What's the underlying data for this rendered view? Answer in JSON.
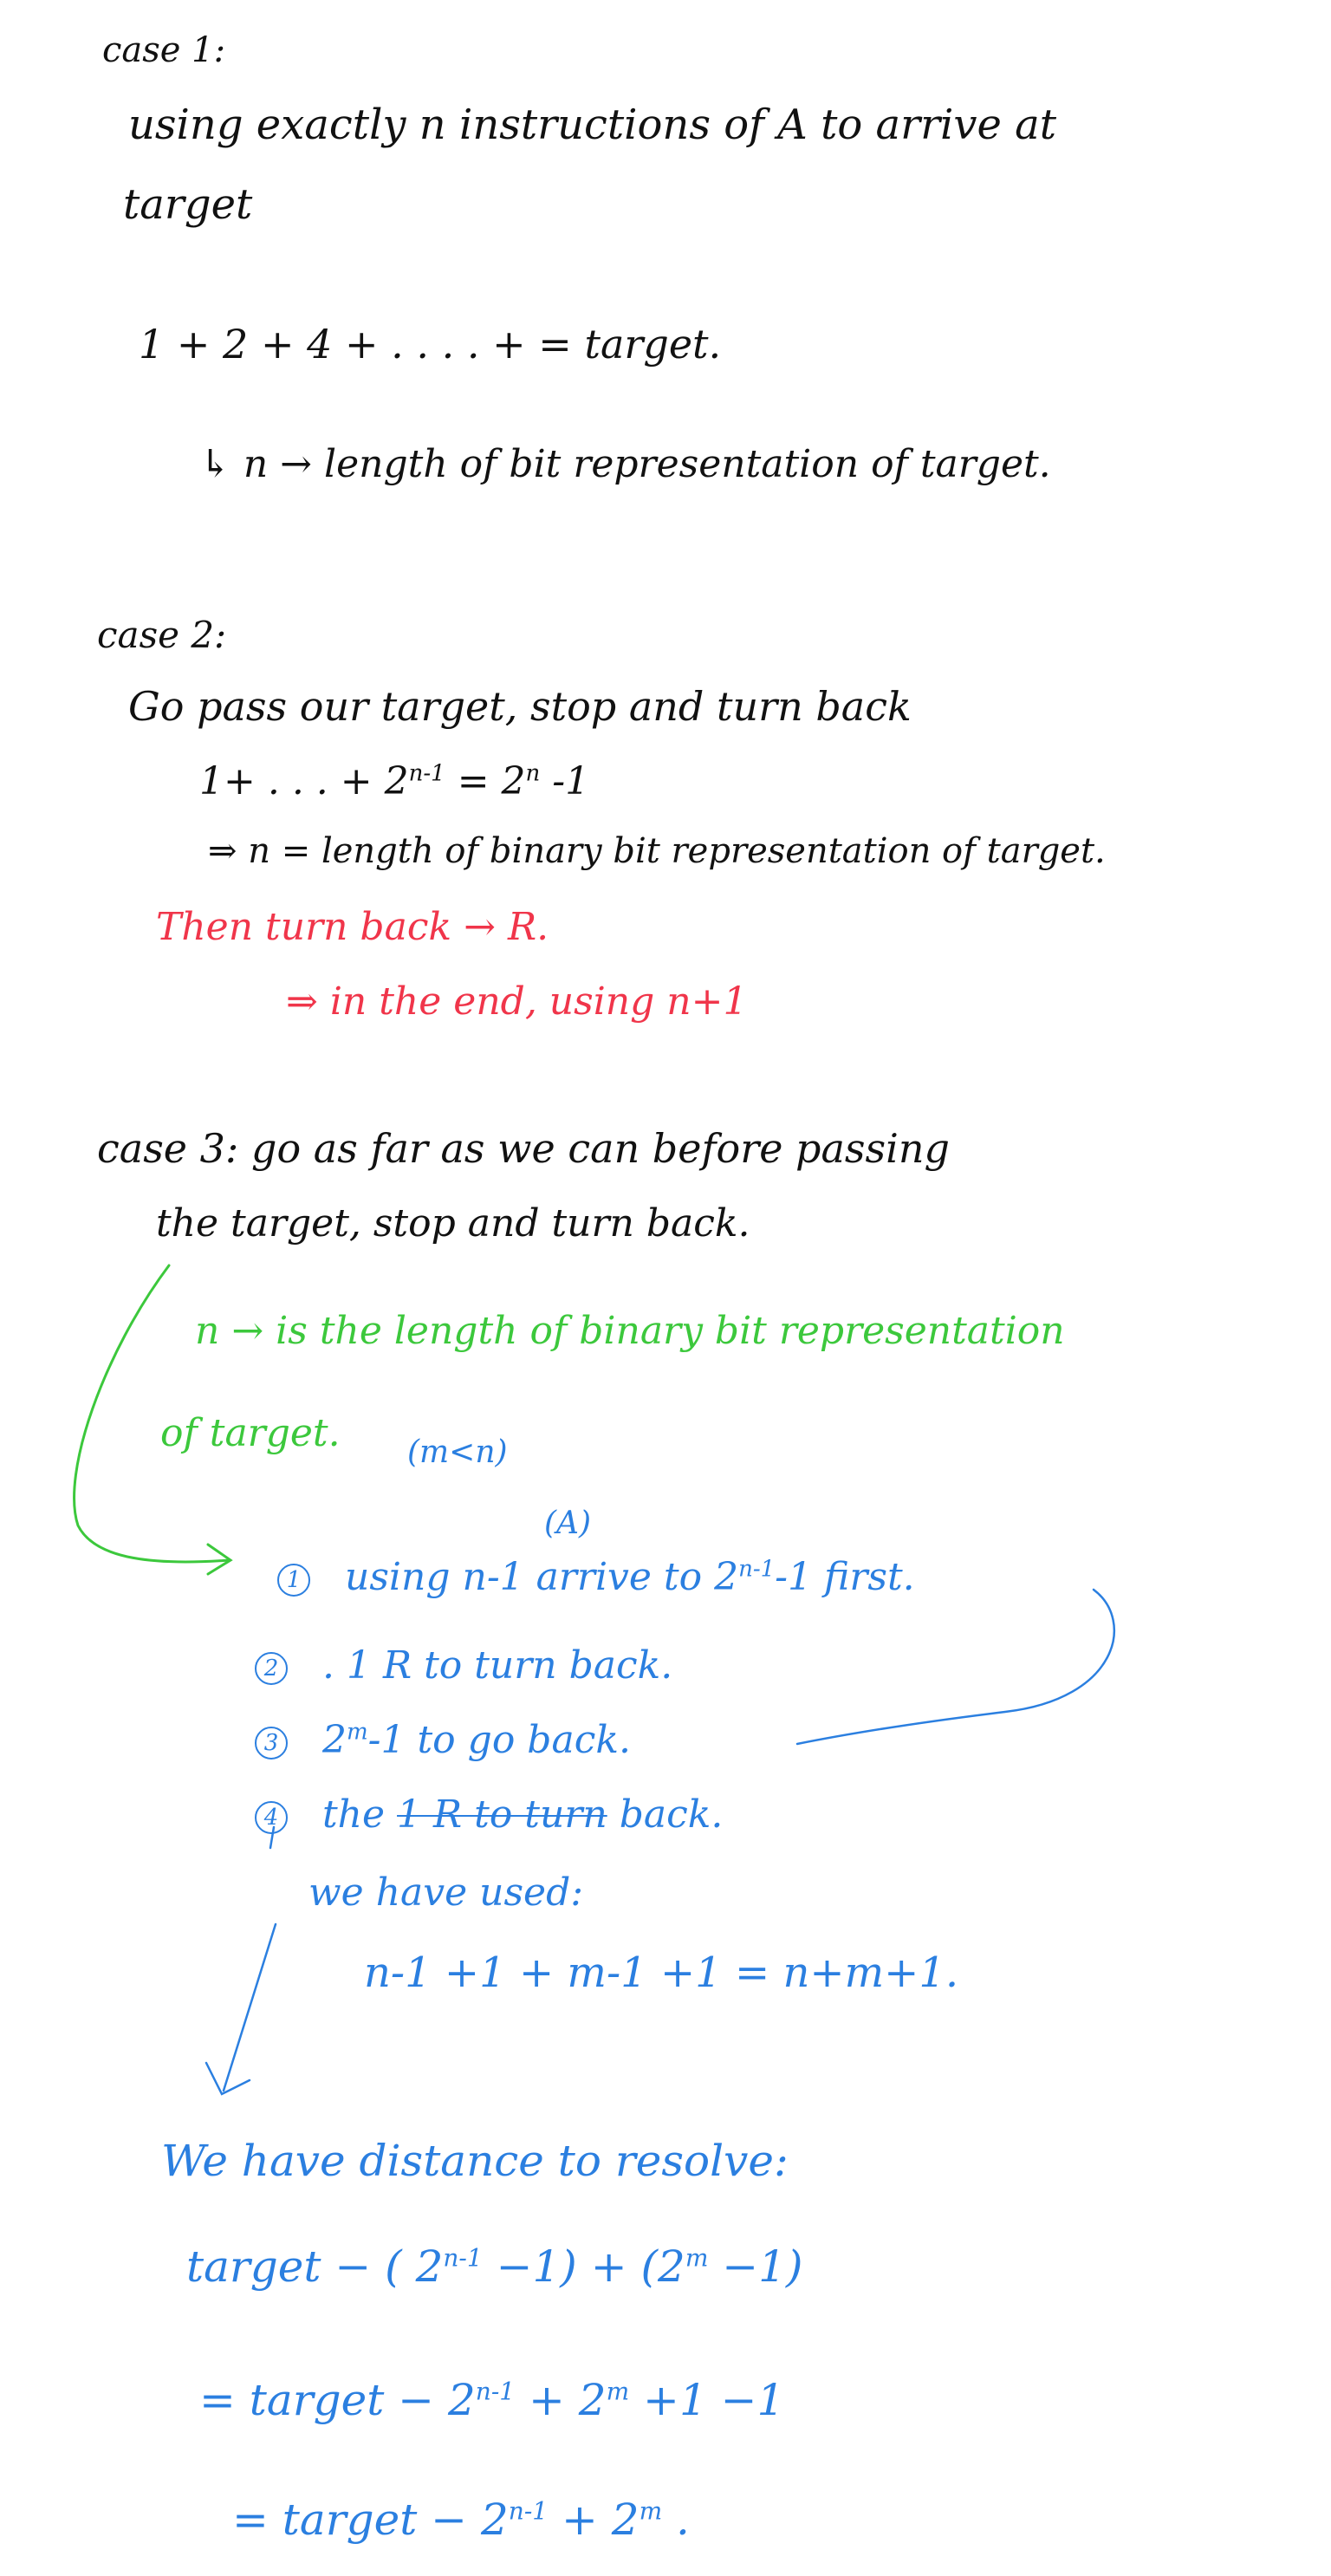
{
  "case1": {
    "heading": "case 1:",
    "line1": "using exactly n instructions of A to arrive at",
    "line2": "target",
    "sum": "1 + 2 + 4 + . . . . +    = target.",
    "note": "↳ n → length of bit representation of target."
  },
  "case2": {
    "heading": "case 2:",
    "line1": "Go pass our target, stop and turn back",
    "sum_lead": "1+ . . . + 2",
    "sum_exp": "n-1",
    "sum_mid": " = 2",
    "sum_exp2": "n",
    "sum_tail": " -1",
    "implies": "⇒ n = length of binary bit representation of target.",
    "red_line1": "Then turn back → R.",
    "red_line2": "⇒ in the end, using n+1"
  },
  "case3": {
    "heading": "case 3: go as far as we can before passing",
    "line2": "the target, stop and turn back.",
    "green_line1": "n → is the length of binary bit representation",
    "green_line2": "of target.",
    "green_cond": "(m<n)",
    "label_a": "(A)",
    "steps": [
      {
        "marker": "1",
        "lead": "using n-1 arrive to 2",
        "exp": "n-1",
        "tail": "-1 first."
      },
      {
        "marker": "2",
        "lead": ". 1 R to turn back.",
        "exp": "",
        "tail": ""
      },
      {
        "marker": "3",
        "lead": "2",
        "exp": "m",
        "tail": "-1 to go back."
      },
      {
        "marker": "4",
        "lead": "the ",
        "strike": "1 R to turn",
        "tail": " back."
      }
    ],
    "used_label": "we have used:",
    "used_expr": "n-1 +1 + m-1 +1 = n+m+1.",
    "dist_label": "We have distance to resolve:",
    "expr1_a": "target − ( 2",
    "expr1_e1": "n-1",
    "expr1_b": " −1) + (2",
    "expr1_e2": "m",
    "expr1_c": " −1)",
    "expr2_a": "= target − 2",
    "expr2_e1": "n-1",
    "expr2_b": " + 2",
    "expr2_e2": "m",
    "expr2_c": " +1 −1",
    "expr3_a": "= target − 2",
    "expr3_e1": "n-1",
    "expr3_b": " + 2",
    "expr3_e2": "m",
    "expr3_c": " ."
  },
  "colors": {
    "black": "#111111",
    "red": "#f0354a",
    "green": "#3cc83c",
    "blue": "#2b7fe0"
  }
}
